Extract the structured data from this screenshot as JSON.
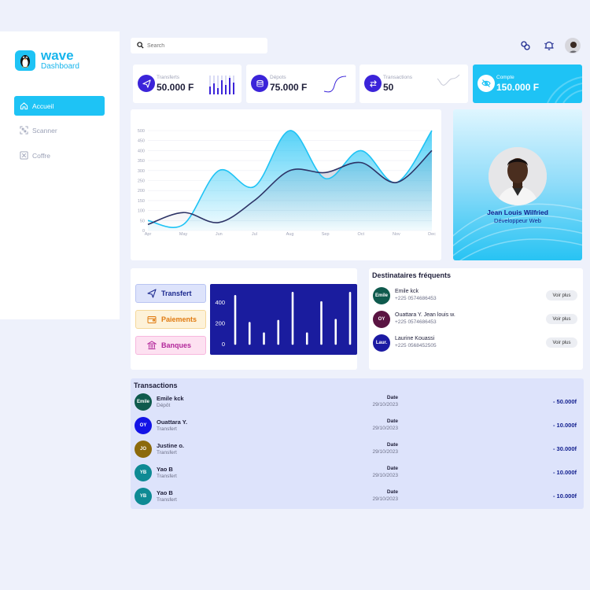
{
  "brand": {
    "name": "wave",
    "subtitle": "Dashboard"
  },
  "sidebar": {
    "items": [
      {
        "label": "Accueil",
        "icon": "home-icon",
        "active": true
      },
      {
        "label": "Scanner",
        "icon": "scanner-icon",
        "active": false
      },
      {
        "label": "Coffre",
        "icon": "vault-icon",
        "active": false
      }
    ]
  },
  "search": {
    "placeholder": "Search"
  },
  "stats": [
    {
      "label": "Transferts",
      "value": "50.000 F",
      "icon": "send-icon"
    },
    {
      "label": "Dépots",
      "value": "75.000 F",
      "icon": "coins-icon"
    },
    {
      "label": "Transactions",
      "value": "50",
      "icon": "swap-icon"
    },
    {
      "label": "Compte",
      "value": "150.000 F",
      "icon": "eye-off-icon"
    }
  ],
  "chart_data": {
    "type": "area",
    "x": [
      "Apr",
      "May",
      "Jun",
      "Jul",
      "Aug",
      "Sep",
      "Oct",
      "Nov",
      "Dec"
    ],
    "yticks": [
      "0",
      "50",
      "100",
      "150",
      "200",
      "250",
      "300",
      "350",
      "400",
      "450",
      "500"
    ],
    "ylim": [
      0,
      500
    ],
    "series": [
      {
        "values": [
          50,
          30,
          300,
          220,
          500,
          260,
          400,
          240,
          500
        ],
        "color": "#1ec3f5"
      },
      {
        "values": [
          30,
          90,
          40,
          150,
          300,
          290,
          340,
          240,
          400
        ],
        "color": "#2d3366"
      }
    ]
  },
  "profile": {
    "name": "Jean Louis Wilfried",
    "role": "Développeur Web"
  },
  "actions": [
    {
      "label": "Transfert",
      "icon": "send-icon",
      "bg": "#dde3fb",
      "border": "#b9c4f2",
      "color": "#1d2a8f"
    },
    {
      "label": "Paiements",
      "icon": "wallet-icon",
      "bg": "#fdf2d9",
      "border": "#f5d89a",
      "color": "#e07a10"
    },
    {
      "label": "Banques",
      "icon": "bank-icon",
      "bg": "#fde1f1",
      "border": "#f7b7de",
      "color": "#b2279a"
    }
  ],
  "bar_chart": {
    "yticks": [
      "0",
      "200",
      "400"
    ],
    "ylim": [
      0,
      500
    ],
    "values": [
      460,
      200,
      100,
      220,
      490,
      100,
      400,
      230,
      490
    ]
  },
  "destinataires": {
    "title": "Destinataires fréquents",
    "button_label": "Voir plus",
    "items": [
      {
        "initials": "Emile",
        "name": "Emile kck",
        "phone": "+225 0574686453",
        "color": "#0f5a4d"
      },
      {
        "initials": "OY",
        "name": "Ouattara Y. Jean louis w.",
        "phone": "+225 0574686453",
        "color": "#5a1442"
      },
      {
        "initials": "Laur.",
        "name": "Laurine Kouassi",
        "phone": "+225 0568452505",
        "color": "#1c1aa3"
      }
    ]
  },
  "transactions": {
    "title": "Transactions",
    "date_label": "Date",
    "items": [
      {
        "initials": "Emile",
        "name": "Emile kck",
        "type": "Dépôt",
        "date": "29/10/2023",
        "amount": "- 50.000f",
        "color": "#0f5a4d"
      },
      {
        "initials": "OY",
        "name": "Ouattara Y.",
        "type": "Transfert",
        "date": "29/10/2023",
        "amount": "- 10.000f",
        "color": "#1212e6"
      },
      {
        "initials": "JO",
        "name": "Justine o.",
        "type": "Transfert",
        "date": "29/10/2023",
        "amount": "- 30.000f",
        "color": "#8c6a0c"
      },
      {
        "initials": "YB",
        "name": "Yao B",
        "type": "Transfert",
        "date": "29/10/2023",
        "amount": "- 10.000f",
        "color": "#0e8a94"
      },
      {
        "initials": "YB",
        "name": "Yao B",
        "type": "Transfert",
        "date": "29/10/2023",
        "amount": "- 10.000f",
        "color": "#0e8a94"
      }
    ]
  }
}
